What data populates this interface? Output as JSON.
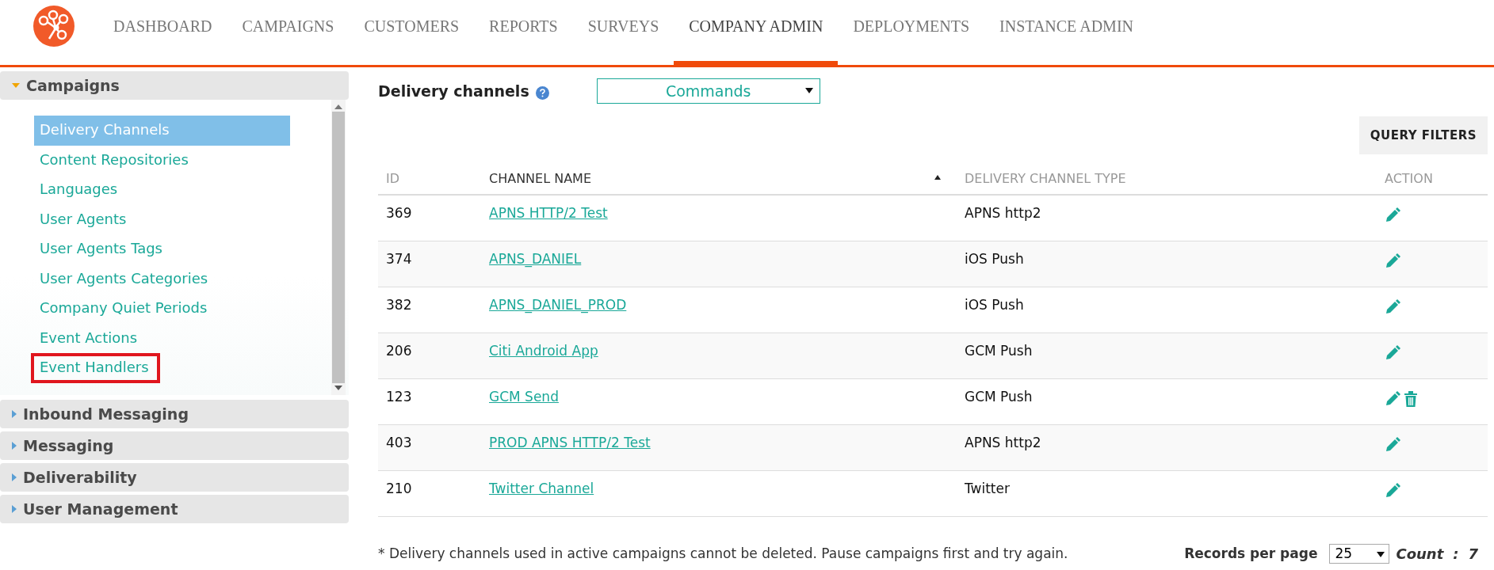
{
  "nav": [
    {
      "label": "DASHBOARD",
      "selected": false
    },
    {
      "label": "CAMPAIGNS",
      "selected": false
    },
    {
      "label": "CUSTOMERS",
      "selected": false
    },
    {
      "label": "REPORTS",
      "selected": false
    },
    {
      "label": "SURVEYS",
      "selected": false
    },
    {
      "label": "COMPANY ADMIN",
      "selected": true
    },
    {
      "label": "DEPLOYMENTS",
      "selected": false
    },
    {
      "label": "INSTANCE ADMIN",
      "selected": false
    }
  ],
  "sidebar": {
    "sections": [
      {
        "title": "Campaigns",
        "expanded": true,
        "items": [
          {
            "label": "Delivery Channels",
            "selected": true,
            "outlined": false
          },
          {
            "label": "Content Repositories",
            "selected": false,
            "outlined": false
          },
          {
            "label": "Languages",
            "selected": false,
            "outlined": false
          },
          {
            "label": "User Agents",
            "selected": false,
            "outlined": false
          },
          {
            "label": "User Agents Tags",
            "selected": false,
            "outlined": false
          },
          {
            "label": "User Agents Categories",
            "selected": false,
            "outlined": false
          },
          {
            "label": "Company Quiet Periods",
            "selected": false,
            "outlined": false
          },
          {
            "label": "Event Actions",
            "selected": false,
            "outlined": false
          },
          {
            "label": "Event Handlers",
            "selected": false,
            "outlined": true
          }
        ]
      },
      {
        "title": "Inbound Messaging",
        "expanded": false
      },
      {
        "title": "Messaging",
        "expanded": false
      },
      {
        "title": "Deliverability",
        "expanded": false
      },
      {
        "title": "User Management",
        "expanded": false
      }
    ]
  },
  "main": {
    "title": "Delivery channels",
    "dropdown": {
      "value": "Commands"
    },
    "query_filters_button": "QUERY FILTERS",
    "table": {
      "columns": [
        {
          "label": "ID",
          "sorted": false
        },
        {
          "label": "CHANNEL NAME",
          "sorted": true
        },
        {
          "label": "DELIVERY CHANNEL TYPE",
          "sorted": false
        },
        {
          "label": "ACTION",
          "sorted": false
        }
      ],
      "rows": [
        {
          "id": "369",
          "name": "APNS HTTP/2 Test",
          "type": "APNS http2",
          "deletable": false
        },
        {
          "id": "374",
          "name": "APNS_DANIEL",
          "type": "iOS Push",
          "deletable": false
        },
        {
          "id": "382",
          "name": "APNS_DANIEL_PROD",
          "type": "iOS Push",
          "deletable": false
        },
        {
          "id": "206",
          "name": "Citi Android App",
          "type": "GCM Push",
          "deletable": false
        },
        {
          "id": "123",
          "name": "GCM Send",
          "type": "GCM Push",
          "deletable": true
        },
        {
          "id": "403",
          "name": "PROD APNS HTTP/2 Test",
          "type": "APNS http2",
          "deletable": false
        },
        {
          "id": "210",
          "name": "Twitter Channel",
          "type": "Twitter",
          "deletable": false
        }
      ]
    },
    "footnote": "* Delivery channels used in active campaigns cannot be deleted. Pause campaigns first and try again.",
    "records_per_page": {
      "label": "Records per page",
      "value": "25"
    },
    "count": {
      "label": "Count",
      "separator": ":",
      "value": "7"
    }
  }
}
